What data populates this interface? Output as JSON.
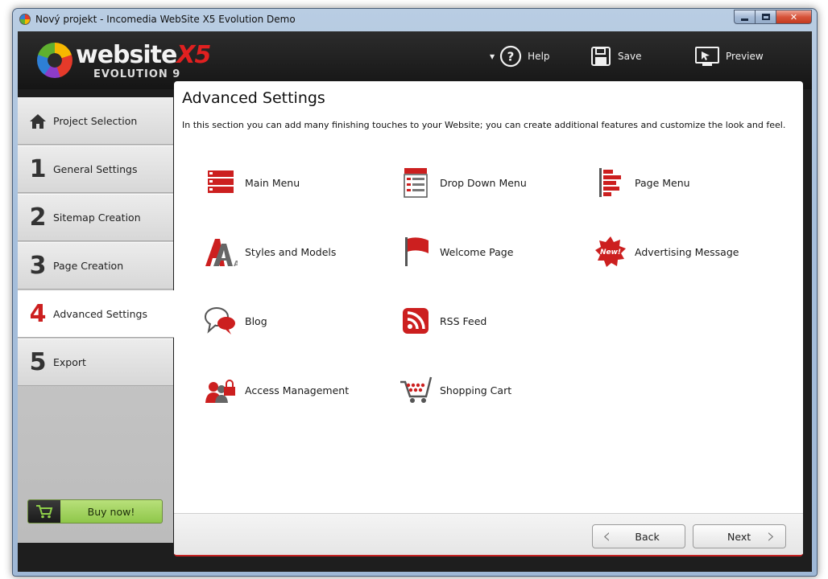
{
  "window": {
    "title": "Nový projekt - Incomedia WebSite X5 Evolution Demo",
    "controls": {
      "minimize": "minimize-icon",
      "maximize": "maximize-icon",
      "close": "close-icon"
    }
  },
  "logo": {
    "word": "website",
    "x5": "X5",
    "edition": "EVOLUTION 9"
  },
  "toolbar": {
    "help_label": "Help",
    "save_label": "Save",
    "preview_label": "Preview"
  },
  "sidebar": {
    "items": [
      {
        "number": "",
        "label": "Project Selection",
        "icon": "home-icon"
      },
      {
        "number": "1",
        "label": "General Settings"
      },
      {
        "number": "2",
        "label": "Sitemap Creation"
      },
      {
        "number": "3",
        "label": "Page Creation"
      },
      {
        "number": "4",
        "label": "Advanced Settings",
        "active": true
      },
      {
        "number": "5",
        "label": "Export"
      }
    ],
    "buy_label": "Buy now!"
  },
  "panel": {
    "title": "Advanced Settings",
    "description": "In this section you can add many finishing touches to your Website; you can create additional features and customize the look and feel.",
    "items": [
      {
        "label": "Main Menu",
        "icon": "main-menu-icon"
      },
      {
        "label": "Drop Down Menu",
        "icon": "drop-down-menu-icon"
      },
      {
        "label": "Page Menu",
        "icon": "page-menu-icon"
      },
      {
        "label": "Styles and Models",
        "icon": "styles-models-icon"
      },
      {
        "label": "Welcome Page",
        "icon": "flag-icon"
      },
      {
        "label": "Advertising Message",
        "icon": "new-badge-icon",
        "badge": "New!"
      },
      {
        "label": "Blog",
        "icon": "speech-bubbles-icon"
      },
      {
        "label": "RSS Feed",
        "icon": "rss-icon"
      },
      {
        "label": "Access Management",
        "icon": "users-lock-icon"
      },
      {
        "label": "Shopping Cart",
        "icon": "cart-icon"
      }
    ]
  },
  "footer": {
    "back_label": "Back",
    "next_label": "Next"
  },
  "colors": {
    "accent": "#cc1f1f",
    "header_bg": "#1e1e1e",
    "buy_green": "#8fc74a"
  }
}
